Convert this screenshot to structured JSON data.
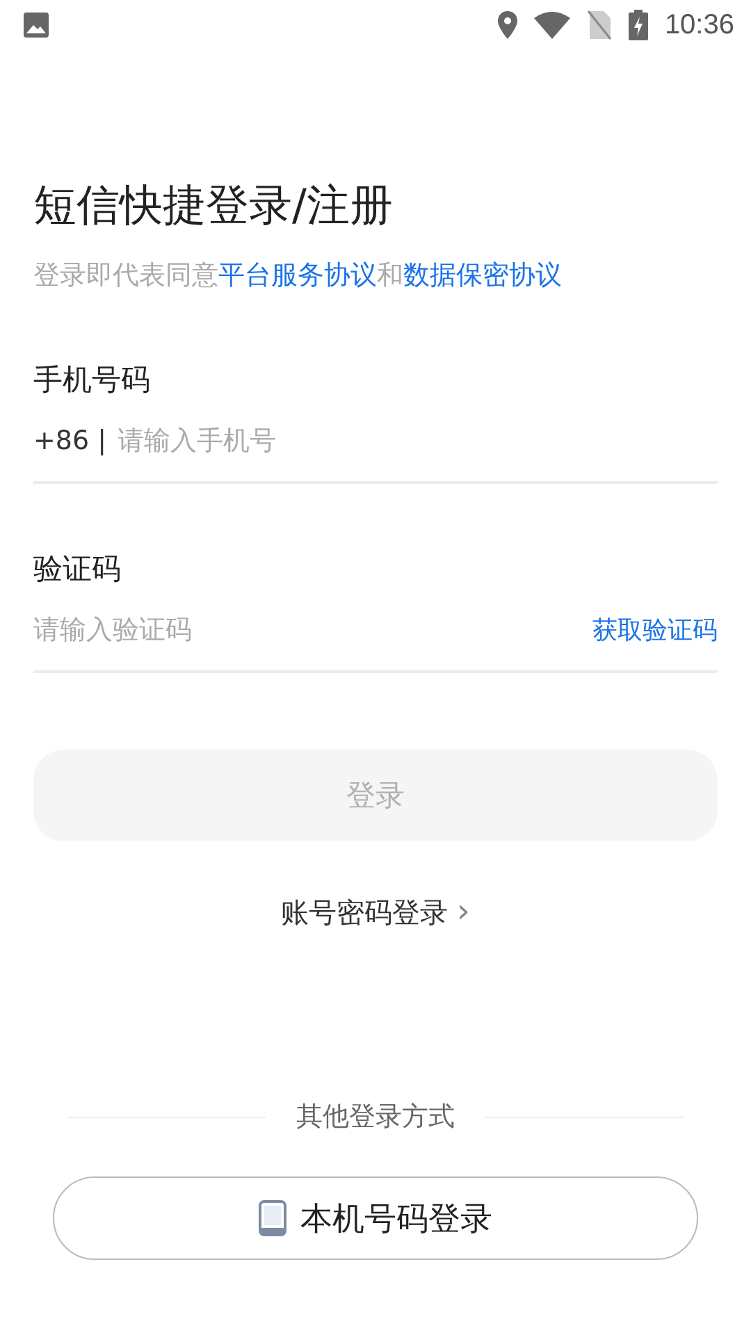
{
  "status_bar": {
    "time": "10:36"
  },
  "title": "短信快捷登录/注册",
  "agreement": [
    {
      "kind": "plain",
      "text": "登录即代表同意"
    },
    {
      "kind": "link",
      "text": "平台服务协议"
    },
    {
      "kind": "plain",
      "text": "和"
    },
    {
      "kind": "link",
      "text": "数据保密协议"
    }
  ],
  "phone": {
    "label": "手机号码",
    "prefix": "+86 |",
    "placeholder": "请输入手机号"
  },
  "code": {
    "label": "验证码",
    "placeholder": "请输入验证码",
    "action": "获取验证码"
  },
  "login_button": {
    "label": "登录",
    "disabled": true
  },
  "password_login": {
    "label": "账号密码登录",
    "chevron": "›"
  },
  "other_methods": {
    "heading": "其他登录方式",
    "button": "本机号码登录"
  }
}
